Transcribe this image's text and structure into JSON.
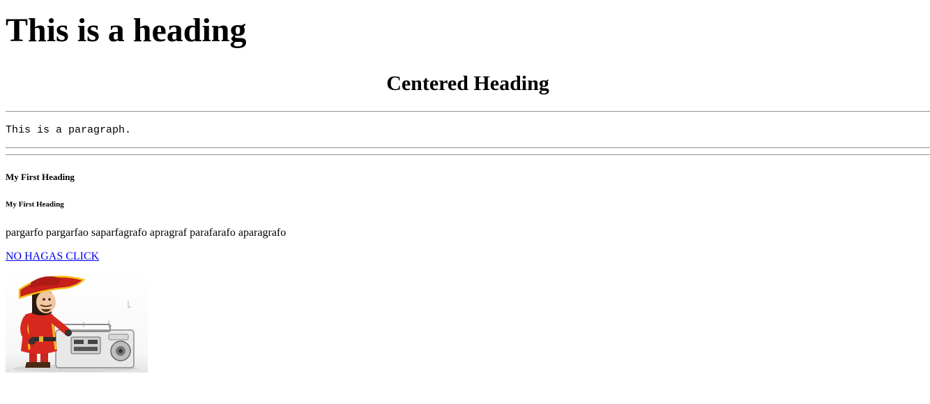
{
  "main_heading": "This is a heading",
  "centered_heading": "Centered Heading",
  "mono_paragraph": "This is a paragraph.",
  "heading_h5": "My First Heading",
  "heading_h6": "My First Heading",
  "body_paragraph": "pargarfo pargarfao saparfagrafo apragraf parafarafo aparagrafo",
  "link": {
    "label": "NO HAGAS CLICK",
    "color": "#0000ee"
  },
  "image": {
    "subject": "pirate-with-boombox-animation"
  },
  "colors": {
    "text": "#000000",
    "link": "#0000ee",
    "background": "#ffffff"
  }
}
